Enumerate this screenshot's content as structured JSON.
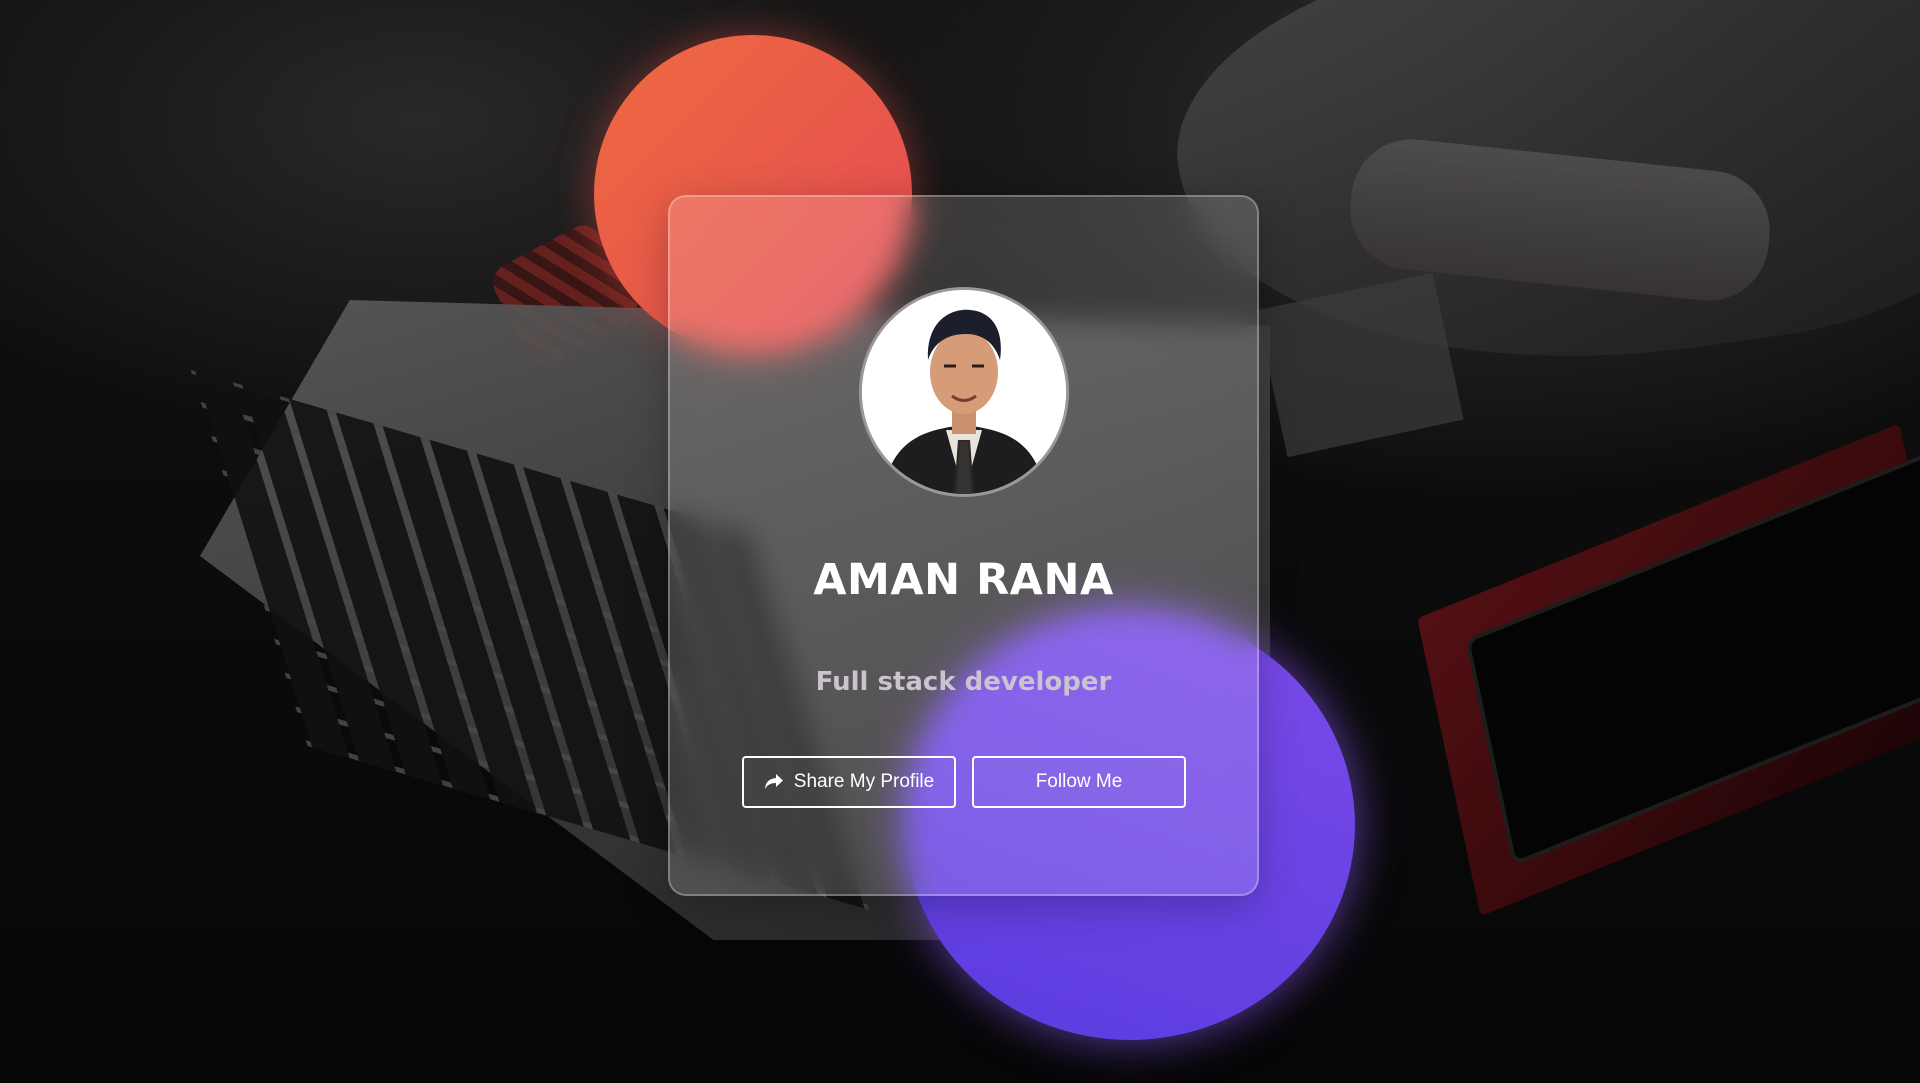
{
  "profile": {
    "name": "AMAN RANA",
    "role": "Full stack developer",
    "avatar_icon": "person-photo-icon"
  },
  "actions": {
    "share_label": "Share My Profile",
    "share_icon": "share-arrow-icon",
    "follow_label": "Follow Me"
  },
  "colors": {
    "red_blob": "#ea5a4b",
    "purple_blob": "#6b45e6",
    "card_border": "#ffffff",
    "text": "#ffffff",
    "subtitle": "#c9c4cf"
  }
}
